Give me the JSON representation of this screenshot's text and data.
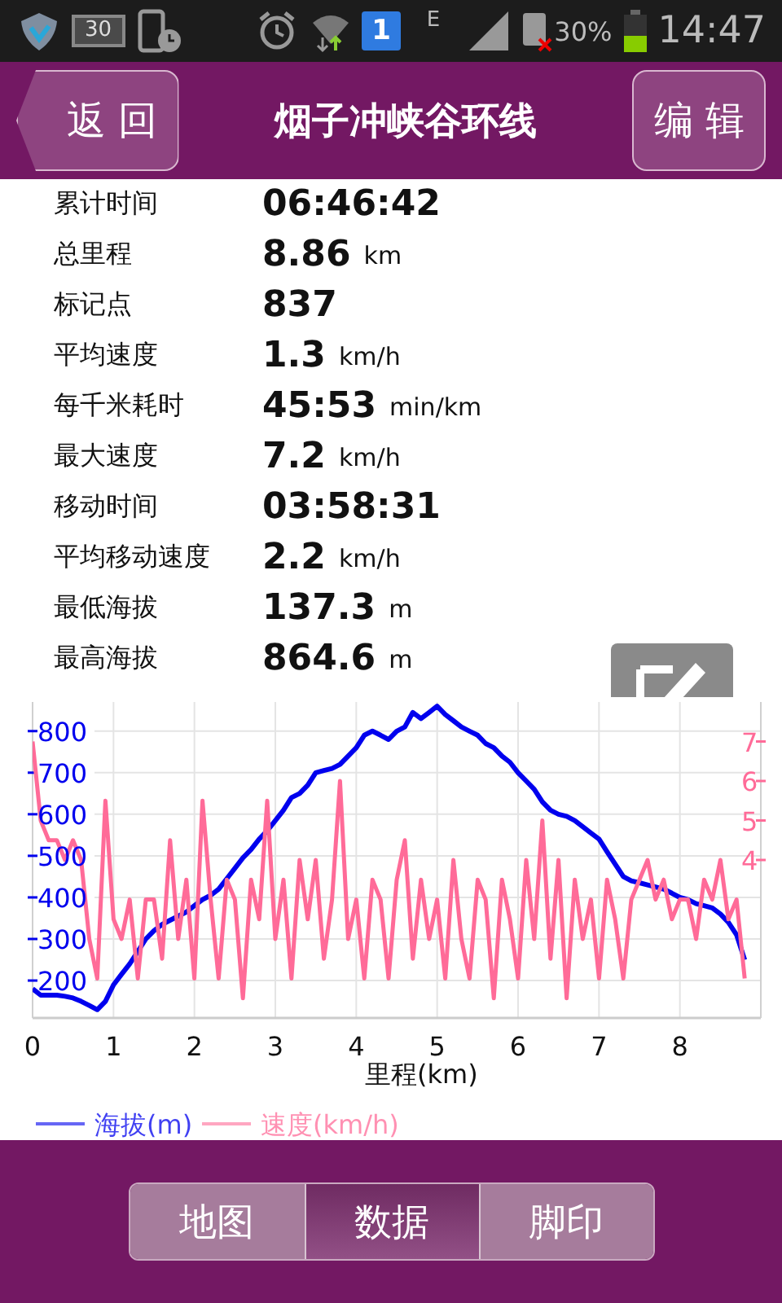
{
  "status_bar": {
    "battery_icon_text": "30",
    "sim_number": "1",
    "network_type": "E",
    "battery_percent": "30%",
    "time": "14:47"
  },
  "header": {
    "back_button": "返 回",
    "title": "烟子冲峡谷环线",
    "edit_button": "编 辑"
  },
  "stats": [
    {
      "label": "累计时间",
      "value": "06:46:42"
    },
    {
      "label": "总里程",
      "value": "8.86",
      "unit": "km"
    },
    {
      "label": "标记点",
      "value": "837"
    },
    {
      "label": "平均速度",
      "value": "1.3",
      "unit": "km/h"
    },
    {
      "label": "每千米耗时",
      "value": "45:53",
      "unit": "min/km"
    },
    {
      "label": "最大速度",
      "value": "7.2",
      "unit": "km/h"
    },
    {
      "label": "移动时间",
      "value": "03:58:31"
    },
    {
      "label": "平均移动速度",
      "value": "2.2",
      "unit": "km/h"
    },
    {
      "label": "最低海拔",
      "value": "137.3",
      "unit": "m"
    },
    {
      "label": "最高海拔",
      "value": "864.6",
      "unit": "m"
    }
  ],
  "chart_data": {
    "type": "line",
    "grid": true,
    "legend": true,
    "xlabel": "里程(km)",
    "xlim": [
      0,
      9
    ],
    "ylim": [
      110,
      870
    ],
    "y2lim": [
      0,
      8
    ],
    "xticks": [
      {
        "value": 0,
        "label": "0"
      },
      {
        "value": 1,
        "label": "1"
      },
      {
        "value": 2,
        "label": "2"
      },
      {
        "value": 3,
        "label": "3"
      },
      {
        "value": 4,
        "label": "4"
      },
      {
        "value": 5,
        "label": "5"
      },
      {
        "value": 6,
        "label": "6"
      },
      {
        "value": 7,
        "label": "7"
      },
      {
        "value": 8,
        "label": "8"
      }
    ],
    "yticks": [
      200,
      300,
      400,
      500,
      600,
      700,
      800
    ],
    "y2ticks": [
      4,
      5,
      6,
      7
    ],
    "x": [
      0,
      0.1,
      0.2,
      0.3,
      0.4,
      0.5,
      0.6,
      0.7,
      0.8,
      0.9,
      1,
      1.1,
      1.2,
      1.3,
      1.4,
      1.5,
      1.6,
      1.7,
      1.8,
      1.9,
      2,
      2.1,
      2.2,
      2.3,
      2.4,
      2.5,
      2.6,
      2.7,
      2.8,
      2.9,
      3,
      3.1,
      3.2,
      3.3,
      3.4,
      3.5,
      3.6,
      3.7,
      3.8,
      3.9,
      4,
      4.1,
      4.2,
      4.3,
      4.4,
      4.5,
      4.6,
      4.7,
      4.8,
      4.9,
      5,
      5.1,
      5.2,
      5.3,
      5.4,
      5.5,
      5.6,
      5.7,
      5.8,
      5.9,
      6,
      6.1,
      6.2,
      6.3,
      6.4,
      6.5,
      6.6,
      6.7,
      6.8,
      6.9,
      7,
      7.1,
      7.2,
      7.3,
      7.4,
      7.5,
      7.6,
      7.7,
      7.8,
      7.9,
      8,
      8.1,
      8.2,
      8.3,
      8.4,
      8.5,
      8.6,
      8.7,
      8.8
    ],
    "series": [
      {
        "name": "海拔(m)",
        "color": "#0000ee",
        "values": [
          180,
          165,
          165,
          165,
          162,
          158,
          150,
          140,
          130,
          150,
          190,
          215,
          240,
          270,
          300,
          320,
          335,
          345,
          355,
          365,
          380,
          395,
          405,
          420,
          445,
          470,
          495,
          515,
          540,
          560,
          585,
          610,
          640,
          650,
          670,
          700,
          705,
          710,
          720,
          740,
          760,
          790,
          800,
          790,
          780,
          800,
          810,
          845,
          830,
          845,
          860,
          840,
          825,
          810,
          800,
          790,
          770,
          760,
          740,
          725,
          700,
          680,
          660,
          630,
          610,
          600,
          595,
          585,
          570,
          555,
          540,
          510,
          480,
          450,
          440,
          435,
          430,
          425,
          420,
          410,
          400,
          395,
          385,
          380,
          375,
          360,
          340,
          310,
          250
        ]
      },
      {
        "name": "速度(km/h)",
        "color": "#ff6b98",
        "axis": "y2",
        "values": [
          7,
          5,
          4.5,
          4.5,
          4,
          4.5,
          4,
          2,
          1,
          5.5,
          2.5,
          2,
          3,
          1,
          3,
          3,
          1.5,
          4.5,
          2,
          3.5,
          1,
          5.5,
          3,
          1,
          3.5,
          3,
          0.5,
          3.5,
          2.5,
          5.5,
          2,
          3.5,
          1,
          4,
          2.5,
          4,
          1.5,
          3,
          6,
          2,
          3,
          1,
          3.5,
          3,
          1,
          3.5,
          4.5,
          1.5,
          3.5,
          2,
          3,
          1,
          4,
          2,
          1,
          3.5,
          3,
          0.5,
          3.5,
          2.5,
          1,
          4,
          2,
          5,
          1.5,
          4,
          0.5,
          3.5,
          2,
          3,
          1,
          3.5,
          2.5,
          1,
          3,
          3.5,
          4,
          3,
          3.5,
          2.5,
          3,
          3,
          2,
          3.5,
          3,
          4,
          2.5,
          3,
          1
        ]
      }
    ]
  },
  "tabs": [
    {
      "label": "地图",
      "selected": false
    },
    {
      "label": "数据",
      "selected": true
    },
    {
      "label": "脚印",
      "selected": false
    }
  ]
}
